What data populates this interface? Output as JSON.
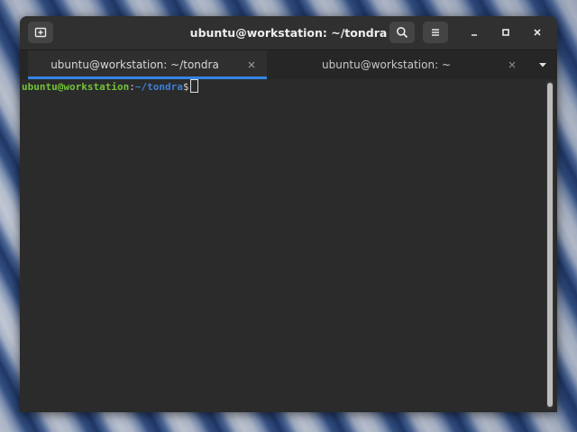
{
  "window": {
    "title": "ubuntu@workstation: ~/tondra"
  },
  "icons": {
    "new_tab": "new-tab-icon",
    "search": "search-icon",
    "menu": "hamburger-menu-icon",
    "minimize": "minimize-icon",
    "maximize": "maximize-icon",
    "close": "close-icon",
    "tab_close": "close-icon",
    "tab_dropdown": "chevron-down-icon"
  },
  "tabs": [
    {
      "label": "ubuntu@workstation: ~/tondra",
      "active": true
    },
    {
      "label": "ubuntu@workstation: ~",
      "active": false
    }
  ],
  "terminal": {
    "prompt_user_host": "ubuntu@workstation",
    "prompt_separator": ":",
    "prompt_path": "~/tondra",
    "prompt_symbol": "$"
  },
  "colors": {
    "accent": "#3584e4",
    "prompt_user": "#73c23a",
    "prompt_path": "#3f7fd8",
    "terminal_bg": "#2b2b2b"
  }
}
